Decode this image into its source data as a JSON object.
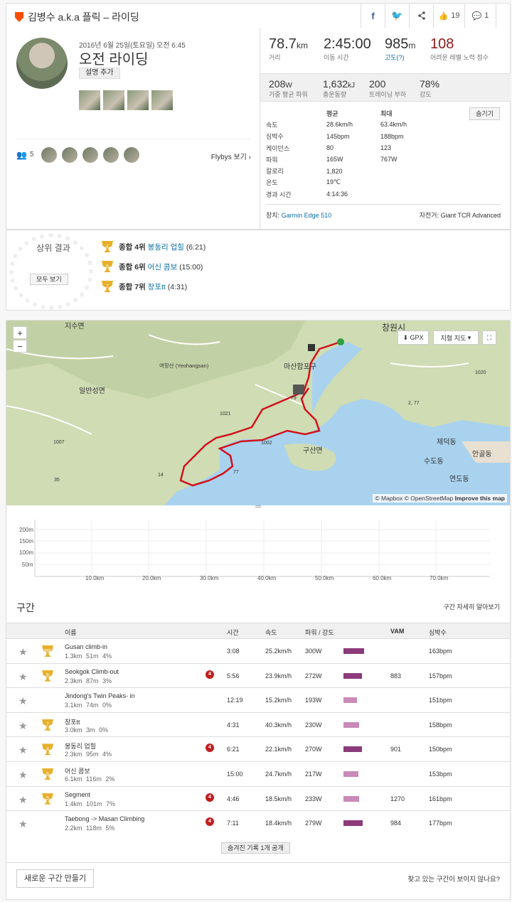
{
  "header": {
    "title": "김병수 a.k.a 플릭 – 라이딩",
    "kudos_count": "19",
    "comment_count": "1"
  },
  "activity": {
    "date": "2016년 6월 25일(토요일) 오전 6:45",
    "title": "오전 라이딩",
    "add_description": "설명 추가"
  },
  "flybys": {
    "count": "5",
    "link": "Flybys 보기"
  },
  "big_stats": [
    {
      "value": "78.7",
      "unit": "km",
      "label": "거리"
    },
    {
      "value": "2:45:00",
      "unit": "",
      "label": "이동 시간"
    },
    {
      "value": "985",
      "unit": "m",
      "label": "고도(?)"
    },
    {
      "value": "108",
      "unit": "",
      "label": "어려운 레벨 노력 점수"
    }
  ],
  "mid_stats": [
    {
      "value": "208",
      "unit": "W",
      "label": "가중 평균 파워"
    },
    {
      "value": "1,632",
      "unit": "kJ",
      "label": "총운동량"
    },
    {
      "value": "200",
      "unit": "",
      "label": "트레이닝 부하"
    },
    {
      "value": "78%",
      "unit": "",
      "label": "강도"
    }
  ],
  "detail": {
    "hide_button": "숨기기",
    "head": {
      "avg": "평균",
      "max": "최대"
    },
    "rows": [
      {
        "label": "속도",
        "avg": "28.6km/h",
        "max": "63.4km/h"
      },
      {
        "label": "심박수",
        "avg": "145bpm",
        "max": "188bpm"
      },
      {
        "label": "케이던스",
        "avg": "80",
        "max": "123"
      },
      {
        "label": "파워",
        "avg": "165W",
        "max": "767W"
      },
      {
        "label": "칼로리",
        "avg": "1,820",
        "max": ""
      },
      {
        "label": "온도",
        "avg": "19℃",
        "max": ""
      },
      {
        "label": "경과 시간",
        "avg": "4:14:36",
        "max": ""
      }
    ],
    "device_label": "장치:",
    "device": "Garmin Edge 510",
    "bike_label": "자전거:",
    "bike": "Giant TCR Advanced"
  },
  "results": {
    "top_label": "상위 결과",
    "see_all": "모두 보기",
    "items": [
      {
        "rank_text": "종합 4위",
        "segment": "봉동리 업힐",
        "time": "(6:21)",
        "trophy": "4"
      },
      {
        "rank_text": "종합 6위",
        "segment": "어신 콤보",
        "time": "(15:00)",
        "trophy": "6"
      },
      {
        "rank_text": "종합 7위",
        "segment": "창포tt",
        "time": "(4:31)",
        "trophy": "7"
      }
    ]
  },
  "map": {
    "gpx": "GPX",
    "map_type": "지형 지도",
    "zoom_in": "+",
    "zoom_out": "−",
    "attribution": "© Mapbox © OpenStreetMap",
    "improve": "Improve this map",
    "labels": [
      "지수면",
      "창원시",
      "여항산 (Yeohangsan)",
      "일반성면",
      "마산합포구",
      "구산면",
      "제덕동",
      "안골동",
      "수도동",
      "연도동",
      "1021",
      "1007",
      "1002",
      "1020",
      "2, 77",
      "79",
      "14",
      "77",
      "35"
    ]
  },
  "elevation": {
    "y_ticks": [
      "200m",
      "150m",
      "100m",
      "50m"
    ],
    "x_ticks": [
      "10.0km",
      "20.0km",
      "30.0km",
      "40.0km",
      "50.0km",
      "60.0km",
      "70.0km"
    ]
  },
  "segments": {
    "title": "구간",
    "help": "구간 자세히 알아보기",
    "columns": {
      "name": "이름",
      "time": "시간",
      "speed": "속도",
      "power": "파워 / 강도",
      "vam": "VAM",
      "hr": "심박수"
    },
    "rows": [
      {
        "name": "Gusan climb-in",
        "meta": "1.3km 51m 4%",
        "time": "3:08",
        "speed": "25.2km/h",
        "power": "300W",
        "vam": "",
        "hr": "163bpm",
        "trophy": "PR",
        "badge": "",
        "intensity": 0.72
      },
      {
        "name": "Seokgok Climb-out",
        "meta": "2.3km 87m 3%",
        "time": "5:56",
        "speed": "23.9km/h",
        "power": "272W",
        "vam": "883",
        "hr": "157bpm",
        "trophy": "8",
        "badge": "4",
        "intensity": 0.66
      },
      {
        "name": "Jindong's Twin Peaks- in",
        "meta": "3.1km 74m 0%",
        "time": "12:19",
        "speed": "15.2km/h",
        "power": "193W",
        "vam": "",
        "hr": "151bpm",
        "trophy": "",
        "badge": "",
        "intensity": 0.47
      },
      {
        "name": "창포tt",
        "meta": "3.0km 3m 0%",
        "time": "4:31",
        "speed": "40.3km/h",
        "power": "230W",
        "vam": "",
        "hr": "158bpm",
        "trophy": "7",
        "badge": "",
        "intensity": 0.56
      },
      {
        "name": "봉동리 업힐",
        "meta": "2.3km 95m 4%",
        "time": "6:21",
        "speed": "22.1km/h",
        "power": "270W",
        "vam": "901",
        "hr": "150bpm",
        "trophy": "4",
        "badge": "4",
        "intensity": 0.65
      },
      {
        "name": "어신 콤보",
        "meta": "6.1km 116m 2%",
        "time": "15:00",
        "speed": "24.7km/h",
        "power": "217W",
        "vam": "",
        "hr": "153bpm",
        "trophy": "6",
        "badge": "",
        "intensity": 0.52
      },
      {
        "name": "Segment",
        "meta": "1.4km 101m 7%",
        "time": "4:46",
        "speed": "18.5km/h",
        "power": "233W",
        "vam": "1270",
        "hr": "161bpm",
        "trophy": "5",
        "badge": "4",
        "intensity": 0.56
      },
      {
        "name": "Taebong -> Masan Climbing",
        "meta": "2.2km 118m 5%",
        "time": "7:11",
        "speed": "18.4km/h",
        "power": "279W",
        "vam": "984",
        "hr": "177bpm",
        "trophy": "",
        "badge": "4",
        "intensity": 0.68
      }
    ],
    "hidden_button": "숨겨진 기록 1개 공개",
    "new_segment": "새로운 구간 만들기",
    "find_segment": "찾고 있는 구간이 보이지 않나요?"
  },
  "colors": {
    "accent": "#fc4c02",
    "link": "#0b6fa4",
    "route": "#d0121b",
    "suffer": "#8b1a1a",
    "trophy": "#e8b02b",
    "bar": "#8c3a7a"
  }
}
